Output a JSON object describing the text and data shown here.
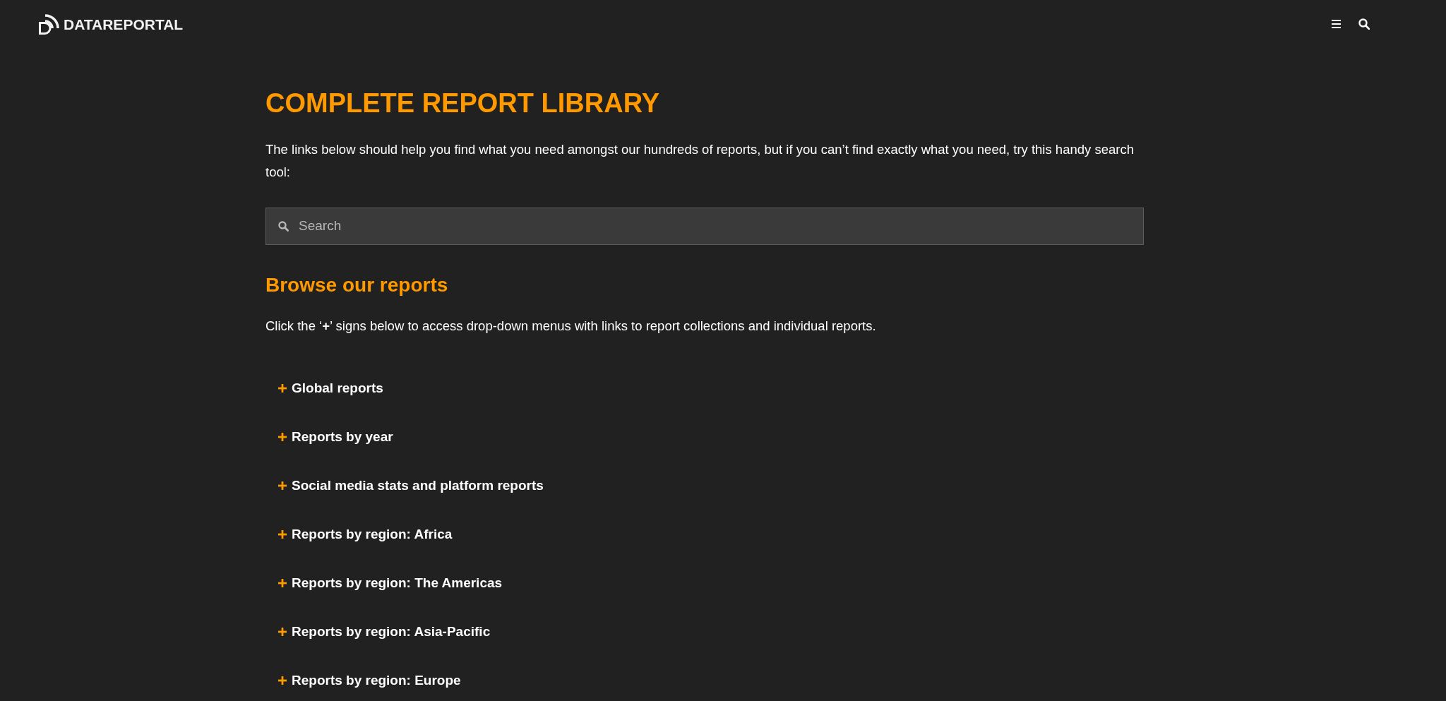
{
  "header": {
    "logo": "DATAREPORTAL"
  },
  "title": "COMPLETE REPORT LIBRARY",
  "intro": "The links below should help you find what you need amongst our hundreds of reports, but if you can’t find exactly what you need, try this handy search tool:",
  "search": {
    "placeholder": "Search"
  },
  "browse": {
    "heading": "Browse our reports",
    "instructions": "Click the ‘**+**’ signs below to access drop-down menus with links to report collections and individual reports."
  },
  "accordion": [
    {
      "label": "Global reports",
      "expanded": false
    },
    {
      "label": "Reports by year",
      "expanded": false
    },
    {
      "label": "Social media stats and platform reports",
      "expanded": false
    },
    {
      "label": "Reports by region: Africa",
      "expanded": false
    },
    {
      "label": "Reports by region: The Americas",
      "expanded": false
    },
    {
      "label": "Reports by region: Asia-Pacific",
      "expanded": false
    },
    {
      "label": "Reports by region: Europe",
      "expanded": false
    }
  ]
}
